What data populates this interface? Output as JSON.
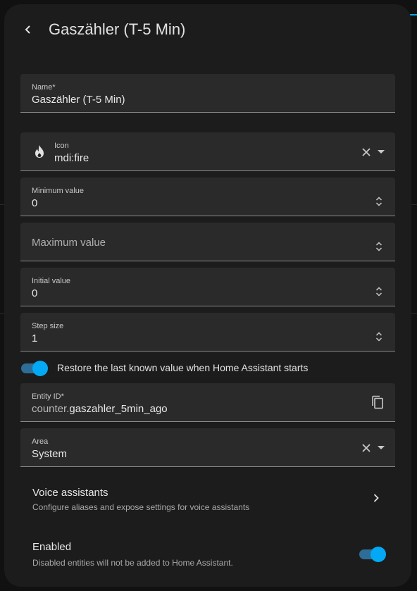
{
  "header": {
    "title": "Gaszähler (T-5 Min)"
  },
  "fields": {
    "name": {
      "label": "Name*",
      "value": "Gaszähler (T-5 Min)"
    },
    "icon": {
      "label": "Icon",
      "value": "mdi:fire",
      "icon_name": "fire-icon"
    },
    "minimum": {
      "label": "Minimum value",
      "value": "0"
    },
    "maximum": {
      "placeholder": "Maximum value",
      "value": ""
    },
    "initial": {
      "label": "Initial value",
      "value": "0"
    },
    "step": {
      "label": "Step size",
      "value": "1"
    },
    "entity_id": {
      "label": "Entity ID*",
      "prefix": "counter.",
      "value": "gaszahler_5min_ago"
    },
    "area": {
      "label": "Area",
      "value": "System"
    }
  },
  "restore": {
    "label": "Restore the last known value when Home Assistant starts",
    "on": true
  },
  "voice": {
    "title": "Voice assistants",
    "subtitle": "Configure aliases and expose settings for voice assistants"
  },
  "enabled": {
    "title": "Enabled",
    "subtitle": "Disabled entities will not be added to Home Assistant.",
    "on": true
  },
  "colors": {
    "accent": "#03a9f4",
    "dialog_bg": "#1c1c1c",
    "field_bg": "#2a2a2a"
  }
}
